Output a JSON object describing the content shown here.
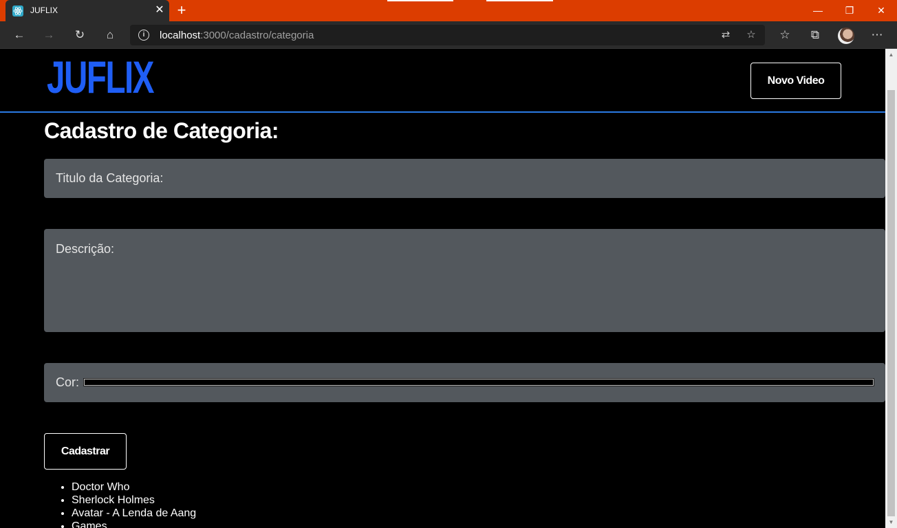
{
  "browser": {
    "tab_title": "JUFLIX",
    "address_host": "localhost",
    "address_path": ":3000/cadastro/categoria"
  },
  "header": {
    "logo_text": "JUFLIX",
    "new_video_button": "Novo Video"
  },
  "form": {
    "title": "Cadastro de Categoria:",
    "title_field_label": "Titulo da Categoria:",
    "description_field_label": "Descrição:",
    "color_field_label": "Cor:",
    "color_value": "#000000",
    "submit_button": "Cadastrar"
  },
  "categories": [
    "Doctor Who",
    "Sherlock Holmes",
    "Avatar - A Lenda de Aang",
    "Games"
  ],
  "colors": {
    "titlebar": "#dc3d00",
    "brand_blue": "#1f5ef5",
    "header_border": "#2a7ae4",
    "field_bg": "#53585d"
  }
}
